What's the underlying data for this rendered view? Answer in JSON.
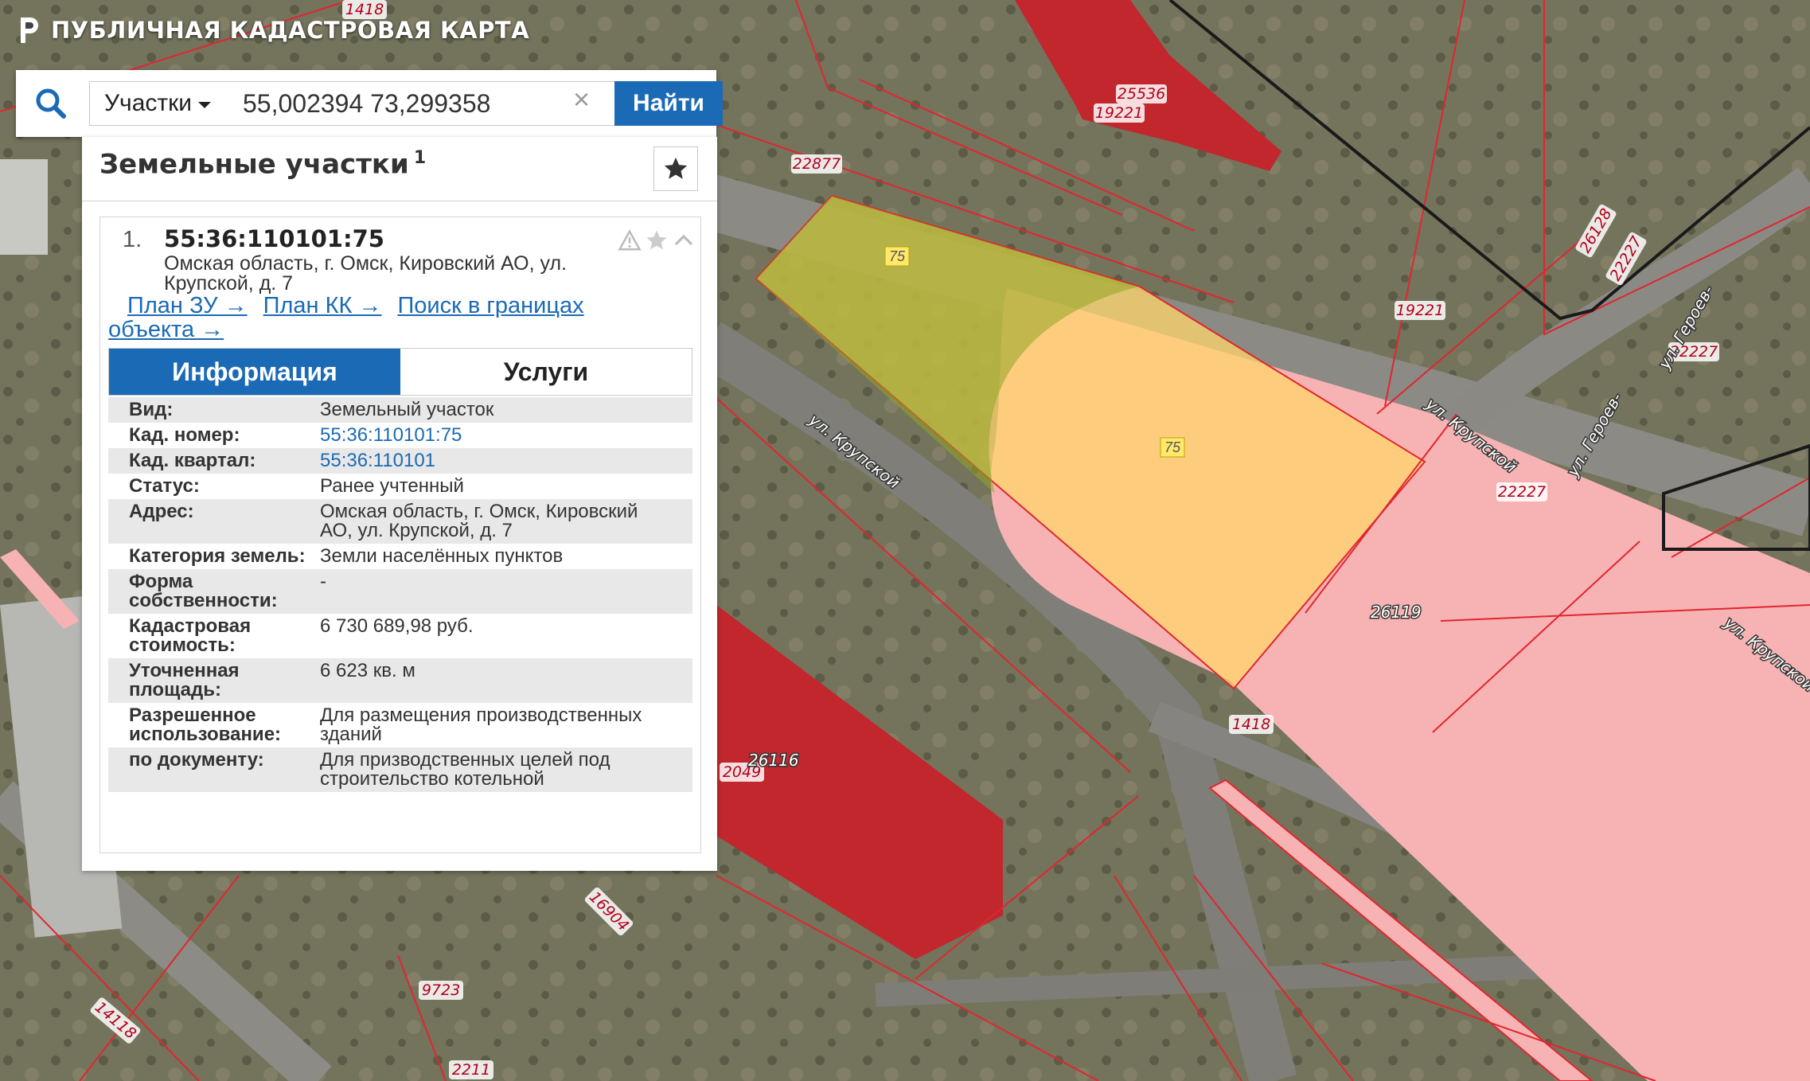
{
  "app": {
    "title": "ПУБЛИЧНАЯ КАДАСТРОВАЯ КАРТА"
  },
  "search": {
    "type_label": "Участки",
    "query": "55,002394 73,299358",
    "clear": "×",
    "button": "Найти"
  },
  "panel": {
    "title": "Земельные участки",
    "count": "1",
    "result": {
      "index": "1.",
      "number": "55:36:110101:75",
      "address_line1": "Омская область, г. Омск, Кировский АО, ул.",
      "address_line2": "Крупской, д. 7",
      "links": [
        "План ЗУ →",
        "План КК →",
        "Поиск в границах объекта →"
      ]
    },
    "tabs": [
      "Информация",
      "Услуги"
    ],
    "info": [
      {
        "k": "Вид:",
        "v": "Земельный участок"
      },
      {
        "k": "Кад. номер:",
        "v": "55:36:110101:75"
      },
      {
        "k": "Кад. квартал:",
        "v": "55:36:110101"
      },
      {
        "k": "Статус:",
        "v": "Ранее учтенный"
      },
      {
        "k": "Адрес:",
        "v": "Омская область, г. Омск, Кировский АО, ул. Крупской, д. 7"
      },
      {
        "k": "Категория земель:",
        "v": "Земли населённых пунктов"
      },
      {
        "k": "Форма собственности:",
        "v": "-"
      },
      {
        "k": "Кадастровая стоимость:",
        "v": "6 730 689,98 руб."
      },
      {
        "k": "Уточненная площадь:",
        "v": "6 623 кв. м"
      },
      {
        "k": "Разрешенное использование:",
        "v": "Для размещения производственных зданий"
      },
      {
        "k": "по документу:",
        "v": "Для призводственных целей под строительство котельной"
      }
    ]
  },
  "map": {
    "plot_labels": [
      "1418",
      "25536",
      "19221",
      "22877",
      "26128",
      "22227",
      "19221",
      "22227",
      "22227",
      "26119",
      "1418",
      "2049",
      "26116",
      "16904",
      "9723",
      "14118",
      "2211",
      "75",
      "75"
    ],
    "street_labels": [
      "ул. Крупской",
      "ул. Крупской",
      "ул. Крупской",
      "ул. Героев-",
      "ул. Героев-"
    ],
    "colors": {
      "red": "#c1272d",
      "pink": "#f7b3b3",
      "yellow": "#ffd66b",
      "boundary": "#e0262f"
    }
  }
}
